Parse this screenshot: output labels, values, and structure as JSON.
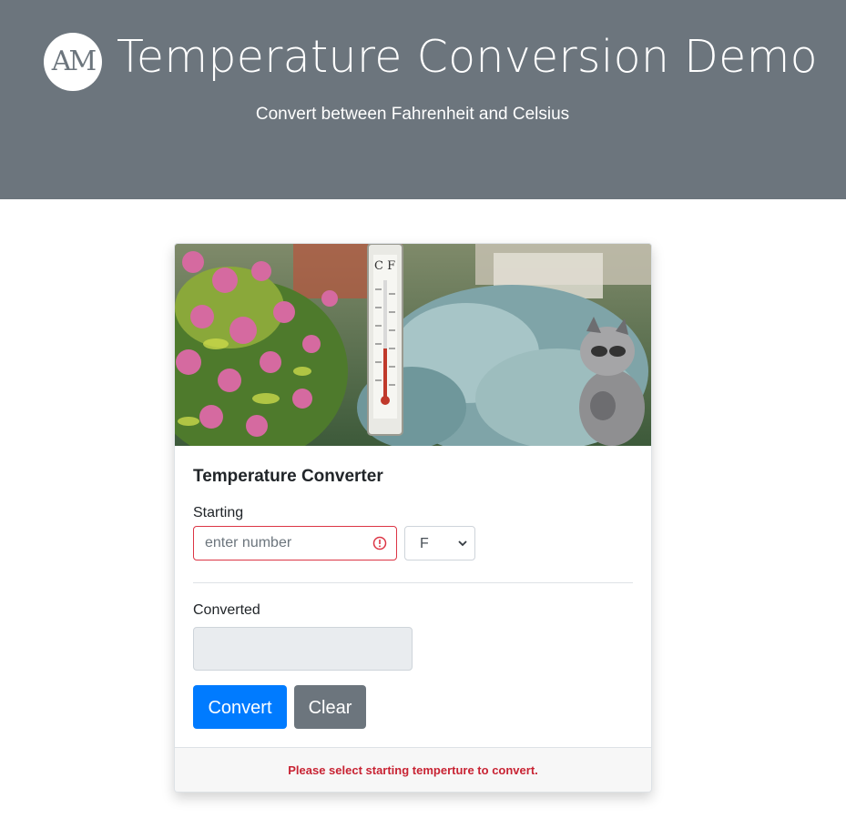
{
  "header": {
    "logo_text": "AM",
    "title": "Temperature Conversion Demo",
    "subtitle": "Convert between Fahrenheit and Celsius"
  },
  "card": {
    "image_alt": "Thermometer in a garden",
    "title": "Temperature Converter",
    "starting_label": "Starting",
    "starting_input": {
      "value": "",
      "placeholder": "enter number",
      "state": "invalid"
    },
    "unit_select": {
      "selected": "F"
    },
    "converted_label": "Converted",
    "converted_value": "",
    "convert_button": "Convert",
    "clear_button": "Clear",
    "footer_message": "Please select starting temperture to convert."
  },
  "colors": {
    "header_bg": "#6c757d",
    "primary": "#007bff",
    "secondary": "#6c757d",
    "danger": "#dc3545"
  },
  "icons": {
    "error": "exclamation-circle-icon",
    "select": "chevron-down-icon"
  }
}
